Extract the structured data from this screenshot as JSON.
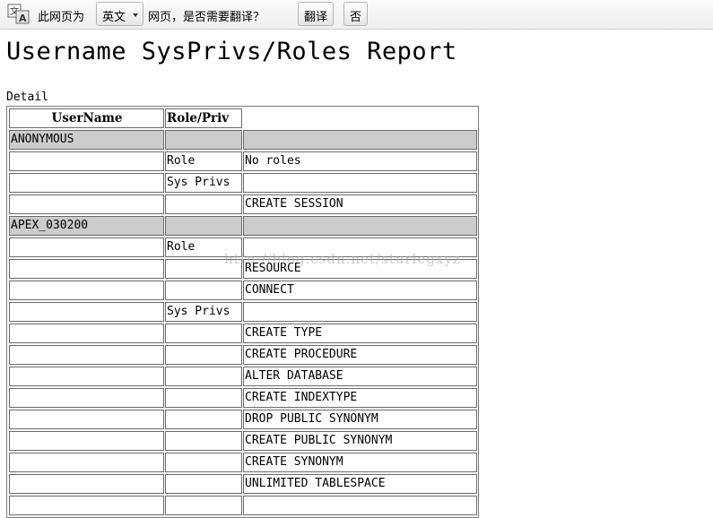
{
  "translate_bar": {
    "text_before": "此网页为",
    "language": "英文",
    "text_after": "网页，是否需要翻译？",
    "translate_button": "翻译",
    "no_button": "否",
    "icon": "translate-icon"
  },
  "report": {
    "title": "Username SysPrivs/Roles Report",
    "caption": "Detail",
    "headers": [
      "UserName",
      "Role/Priv",
      ""
    ],
    "rows": [
      {
        "type": "user",
        "cells": [
          "ANONYMOUS",
          "",
          ""
        ]
      },
      {
        "type": "detail",
        "cells": [
          "",
          "Role",
          "No roles"
        ]
      },
      {
        "type": "detail",
        "cells": [
          "",
          "Sys Privs",
          ""
        ]
      },
      {
        "type": "detail",
        "cells": [
          "",
          "",
          "CREATE SESSION"
        ]
      },
      {
        "type": "user",
        "cells": [
          "APEX_030200",
          "",
          ""
        ]
      },
      {
        "type": "detail",
        "cells": [
          "",
          "Role",
          ""
        ]
      },
      {
        "type": "detail",
        "cells": [
          "",
          "",
          "RESOURCE"
        ]
      },
      {
        "type": "detail",
        "cells": [
          "",
          "",
          "CONNECT"
        ]
      },
      {
        "type": "detail",
        "cells": [
          "",
          "Sys Privs",
          ""
        ]
      },
      {
        "type": "detail",
        "cells": [
          "",
          "",
          "CREATE TYPE"
        ]
      },
      {
        "type": "detail",
        "cells": [
          "",
          "",
          "CREATE PROCEDURE"
        ]
      },
      {
        "type": "detail",
        "cells": [
          "",
          "",
          "ALTER DATABASE"
        ]
      },
      {
        "type": "detail",
        "cells": [
          "",
          "",
          "CREATE INDEXTYPE"
        ]
      },
      {
        "type": "detail",
        "cells": [
          "",
          "",
          "DROP PUBLIC SYNONYM"
        ]
      },
      {
        "type": "detail",
        "cells": [
          "",
          "",
          "CREATE PUBLIC SYNONYM"
        ]
      },
      {
        "type": "detail",
        "cells": [
          "",
          "",
          "CREATE SYNONYM"
        ]
      },
      {
        "type": "detail",
        "cells": [
          "",
          "",
          "UNLIMITED TABLESPACE"
        ]
      },
      {
        "type": "detail",
        "cells": [
          "",
          "",
          ""
        ]
      }
    ]
  },
  "watermark": "http://blog.csdn.net/sturlegxyz",
  "colors": {
    "user_row_bg": "#cccccc",
    "border": "#6a6a6a"
  }
}
